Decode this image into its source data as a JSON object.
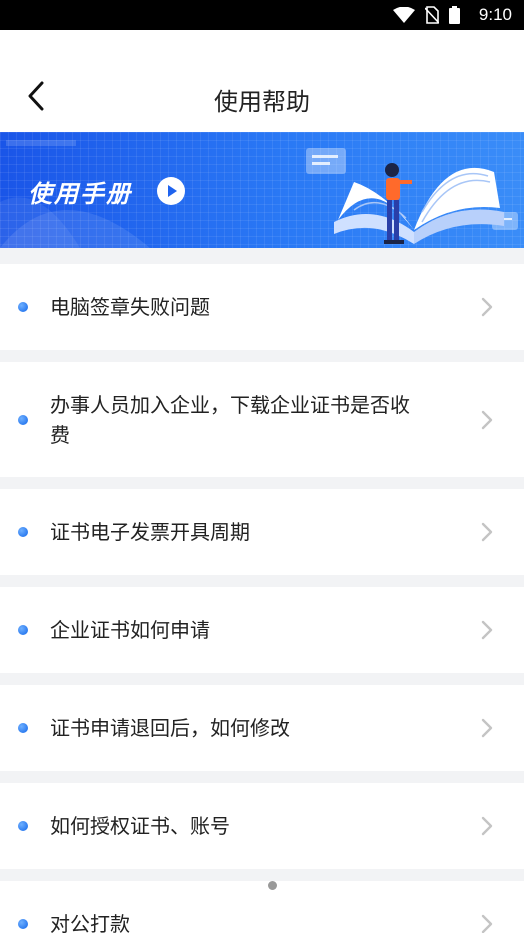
{
  "status_bar": {
    "time": "9:10",
    "icons": [
      "wifi-icon",
      "no-sim-icon",
      "battery-icon"
    ]
  },
  "header": {
    "title": "使用帮助",
    "back_icon": "chevron-left-icon"
  },
  "banner": {
    "title": "使用手册",
    "play_icon": "play-icon",
    "colors": {
      "start": "#1a55e8",
      "end": "#3a8df8"
    }
  },
  "help_items": [
    {
      "label": "电脑签章失败问题"
    },
    {
      "label": "办事人员加入企业，下载企业证书是否收费"
    },
    {
      "label": "证书电子发票开具周期"
    },
    {
      "label": "企业证书如何申请"
    },
    {
      "label": "证书申请退回后，如何修改"
    },
    {
      "label": "如何授权证书、账号"
    },
    {
      "label": "对公打款"
    }
  ],
  "colors": {
    "bullet": "#2d7cf0",
    "chevron": "#c4c4c4",
    "divider": "#f2f3f5"
  }
}
